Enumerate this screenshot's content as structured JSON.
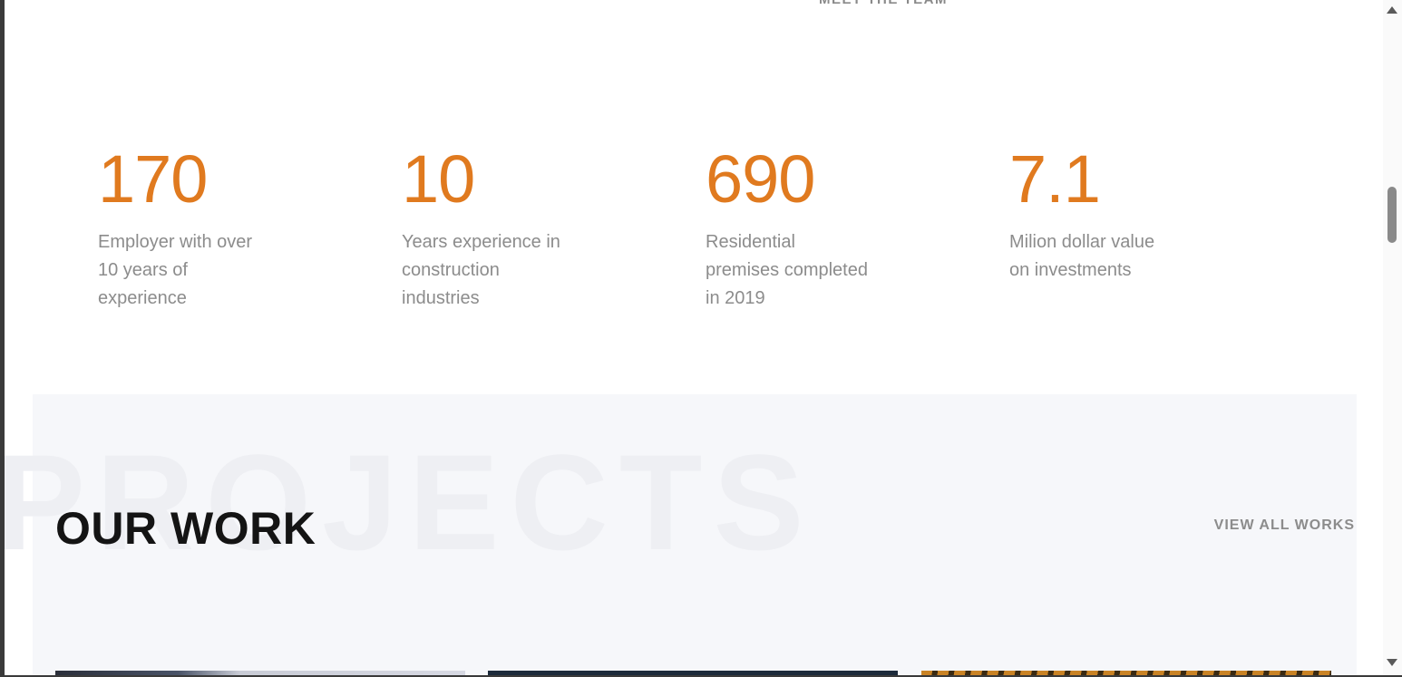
{
  "header": {
    "meet_team_label": "MEET THE TEAM"
  },
  "stats": [
    {
      "number": "170",
      "description": "Employer with over 10 years of experience"
    },
    {
      "number": "10",
      "description": "Years experience in construction industries"
    },
    {
      "number": "690",
      "description": "Residential premises completed in 2019"
    },
    {
      "number": "7.1",
      "description": "Milion dollar value on investments"
    }
  ],
  "projects": {
    "background_word": "PROJECTS",
    "title": "OUR WORK",
    "view_all_label": "VIEW ALL WORKS"
  },
  "colors": {
    "accent": "#e07a1f",
    "section_bg": "#f6f7fa",
    "title": "#141414",
    "muted_text": "#8c8c8c"
  }
}
